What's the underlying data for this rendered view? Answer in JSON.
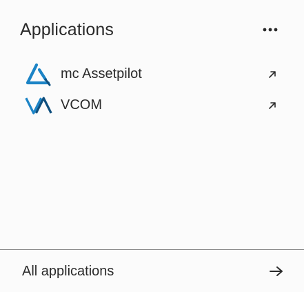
{
  "panel": {
    "title": "Applications",
    "more_icon": "more-horizontal-icon"
  },
  "apps": [
    {
      "name": "mc Assetpilot",
      "logo": "assetpilot-logo",
      "action_icon": "external-link-icon",
      "brand_color": "#1c84c6"
    },
    {
      "name": "VCOM",
      "logo": "vcom-logo",
      "action_icon": "external-link-icon",
      "brand_color": "#1c84c6"
    }
  ],
  "footer": {
    "label": "All applications",
    "icon": "arrow-right-icon"
  },
  "colors": {
    "background": "#fbfbfb",
    "text": "#2a2a2a",
    "divider": "#8c8c8c",
    "brand": "#1c84c6"
  }
}
